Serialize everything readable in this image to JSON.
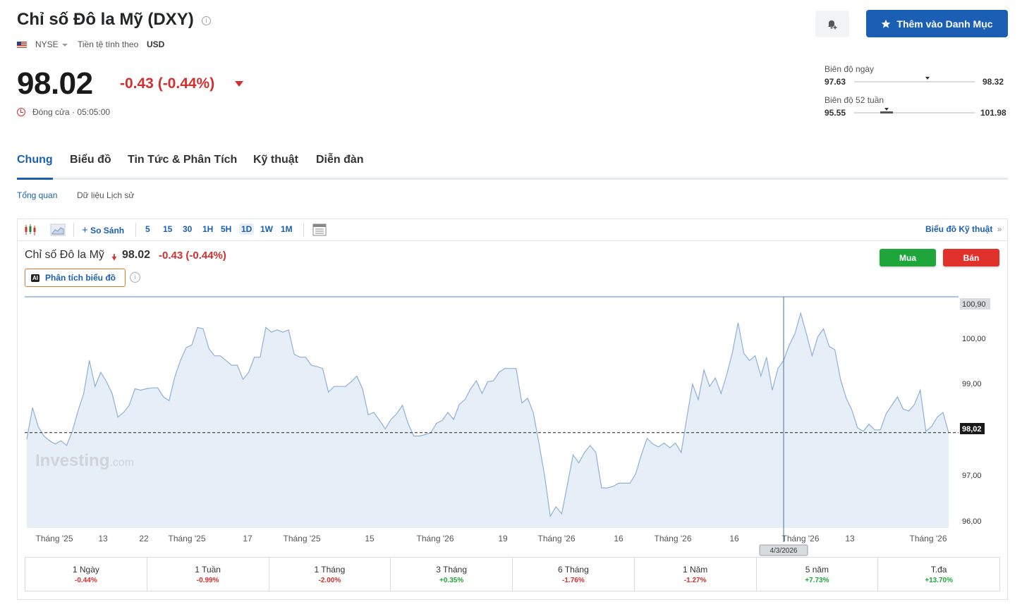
{
  "header": {
    "title": "Chỉ số Đô la Mỹ (DXY)",
    "exchange": "NYSE",
    "currency_label": "Tiền tệ tính theo",
    "currency": "USD",
    "price": "98.02",
    "change": "-0.43 (-0.44%)",
    "status": "Đóng cửa · 05:05:00",
    "watchlist_button": "Thêm vào Danh Mục"
  },
  "ranges": {
    "day": {
      "label": "Biên độ ngày",
      "low": "97.63",
      "high": "98.32",
      "position": 0.61
    },
    "week52": {
      "label": "Biên độ 52 tuần",
      "low": "95.55",
      "high": "101.98",
      "position": 0.27
    }
  },
  "tabs": [
    "Chung",
    "Biểu đồ",
    "Tin Tức & Phân Tích",
    "Kỹ thuật",
    "Diễn đàn"
  ],
  "subtabs": [
    "Tổng quan",
    "Dữ liệu Lịch sử"
  ],
  "toolbar": {
    "compare": "So Sánh",
    "intervals": [
      "5",
      "15",
      "30",
      "1H",
      "5H",
      "1D",
      "1W",
      "1M"
    ],
    "selected_interval": "1D",
    "technical_chart_link": "Biểu đồ Kỹ thuật"
  },
  "chart_header": {
    "name": "Chỉ số Đô la Mỹ",
    "price": "98.02",
    "change": "-0.43 (-0.44%)",
    "ai_button": "Phân tích biểu đồ",
    "buy": "Mua",
    "sell": "Bán"
  },
  "colors": {
    "accent": "#1b5fb4",
    "down": "#d32f2f",
    "up": "#1fa63a"
  },
  "watermark": {
    "brand": "Investing",
    "suffix": ".com"
  },
  "chart_data": {
    "type": "area",
    "ylim": [
      96.0,
      100.9
    ],
    "y_ticks": [
      "100,90",
      "100,00",
      "99,00",
      "98,02",
      "97,00",
      "96,00"
    ],
    "last_price_label": "98,02",
    "last_price": 98.02,
    "x_ticks": [
      "Tháng '25",
      "13",
      "22",
      "Tháng '25",
      "17",
      "Tháng '25",
      "15",
      "Tháng '26",
      "19",
      "Tháng '26",
      "16",
      "Tháng '26",
      "16",
      "Tháng '26",
      "13",
      "Tháng '26"
    ],
    "crosshair_label": "4/3/2026",
    "crosshair_index": 133,
    "values": [
      97.88,
      98.55,
      98.15,
      97.95,
      97.85,
      97.78,
      97.85,
      97.75,
      98.05,
      98.48,
      98.85,
      99.55,
      99.0,
      99.3,
      99.1,
      98.85,
      98.35,
      98.45,
      98.6,
      98.95,
      98.92,
      98.95,
      98.97,
      98.97,
      98.78,
      98.7,
      99.2,
      99.55,
      99.82,
      99.88,
      100.25,
      100.22,
      99.8,
      99.65,
      99.65,
      99.55,
      99.45,
      99.45,
      99.15,
      99.3,
      99.62,
      99.62,
      100.25,
      100.15,
      100.2,
      100.15,
      100.2,
      99.68,
      99.62,
      99.62,
      99.45,
      99.42,
      99.38,
      98.88,
      99.0,
      99.0,
      99.0,
      99.1,
      99.22,
      98.95,
      98.4,
      98.45,
      98.28,
      98.1,
      98.3,
      98.42,
      98.6,
      98.22,
      97.95,
      97.95,
      97.98,
      98.02,
      98.22,
      98.28,
      98.45,
      98.3,
      98.62,
      98.72,
      98.95,
      99.12,
      98.85,
      99.1,
      99.12,
      99.3,
      99.38,
      99.38,
      99.38,
      98.65,
      98.75,
      98.45,
      97.8,
      97.1,
      96.25,
      96.45,
      96.3,
      96.92,
      97.55,
      97.38,
      97.6,
      97.75,
      97.6,
      96.85,
      96.85,
      96.88,
      96.95,
      96.95,
      96.95,
      97.15,
      97.55,
      97.9,
      97.78,
      97.72,
      97.8,
      97.7,
      97.8,
      97.6,
      98.35,
      99.05,
      98.72,
      99.35,
      99.0,
      99.18,
      98.85,
      99.25,
      99.72,
      100.35,
      99.7,
      99.55,
      99.65,
      99.22,
      99.62,
      98.92,
      99.38,
      99.55,
      99.88,
      100.12,
      100.55,
      100.12,
      99.65,
      100.05,
      100.22,
      99.85,
      99.78,
      99.15,
      98.75,
      98.5,
      98.12,
      98.05,
      98.2,
      98.08,
      98.08,
      98.42,
      98.6,
      98.78,
      98.52,
      98.48,
      98.62,
      98.92,
      98.05,
      98.15,
      98.35,
      98.45,
      98.02
    ]
  },
  "performance": [
    {
      "label": "1 Ngày",
      "value": "-0.44%"
    },
    {
      "label": "1 Tuần",
      "value": "-0.99%"
    },
    {
      "label": "1 Tháng",
      "value": "-2.00%"
    },
    {
      "label": "3 Tháng",
      "value": "+0.35%"
    },
    {
      "label": "6 Tháng",
      "value": "-1.76%"
    },
    {
      "label": "1 Năm",
      "value": "-1.27%"
    },
    {
      "label": "5 năm",
      "value": "+7.73%"
    },
    {
      "label": "T.đa",
      "value": "+13.70%"
    }
  ]
}
